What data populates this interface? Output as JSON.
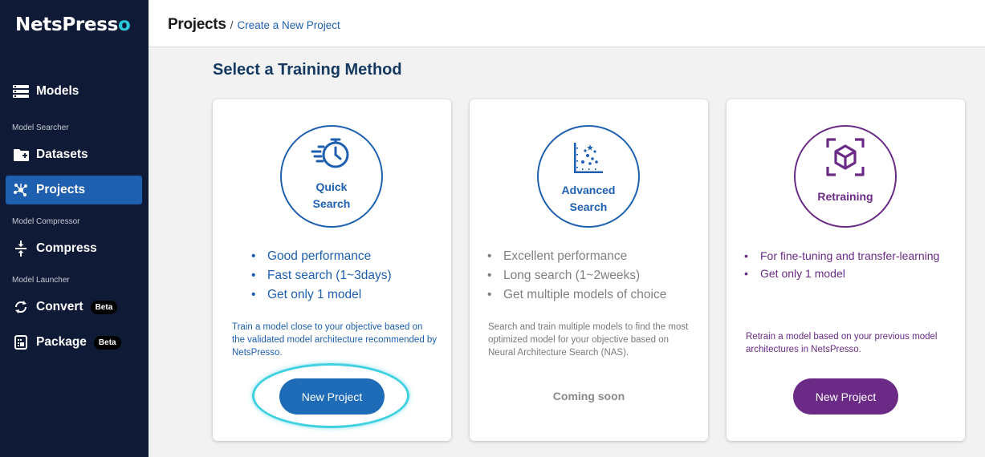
{
  "app": {
    "logo_main": "NetsPress",
    "logo_accent": "o"
  },
  "sidebar": {
    "models": "Models",
    "section_searcher": "Model Searcher",
    "datasets": "Datasets",
    "projects": "Projects",
    "section_compressor": "Model Compressor",
    "compress": "Compress",
    "section_launcher": "Model Launcher",
    "convert": "Convert",
    "convert_badge": "Beta",
    "package": "Package",
    "package_badge": "Beta"
  },
  "header": {
    "crumb_root": "Projects",
    "separator": "/",
    "crumb_current": "Create a New Project"
  },
  "main": {
    "title": "Select a Training Method",
    "cards": [
      {
        "name_line1": "Quick",
        "name_line2": "Search",
        "bullets": [
          "Good performance",
          "Fast search (1~3days)",
          "Get only 1 model"
        ],
        "description": "Train a model close to your objective based on the validated model architecture recommended by NetsPresso.",
        "action": "New Project",
        "color": "#1e5fb0"
      },
      {
        "name_line1": "Advanced",
        "name_line2": "Search",
        "bullets": [
          "Excellent performance",
          "Long search (1~2weeks)",
          "Get multiple models of choice"
        ],
        "description": "Search and train multiple models to find the most optimized model for your objective based on Neural Architecture Search (NAS).",
        "action": "Coming soon",
        "color": "#1e5fb0"
      },
      {
        "name_line1": "Retraining",
        "bullets": [
          "For fine-tuning and transfer-learning",
          "Get only 1 model"
        ],
        "description": "Retrain a model based on your previous model architectures in NetsPresso.",
        "action": "New Project",
        "color": "#6a2a86"
      }
    ]
  },
  "icons": {
    "models": "list-icon",
    "datasets": "folder-plus-icon",
    "projects": "network-icon",
    "compress": "compress-icon",
    "convert": "refresh-icon",
    "package": "package-icon",
    "quick": "fast-stopwatch-icon",
    "advanced": "scatter-plot-icon",
    "retraining": "cube-icon"
  }
}
